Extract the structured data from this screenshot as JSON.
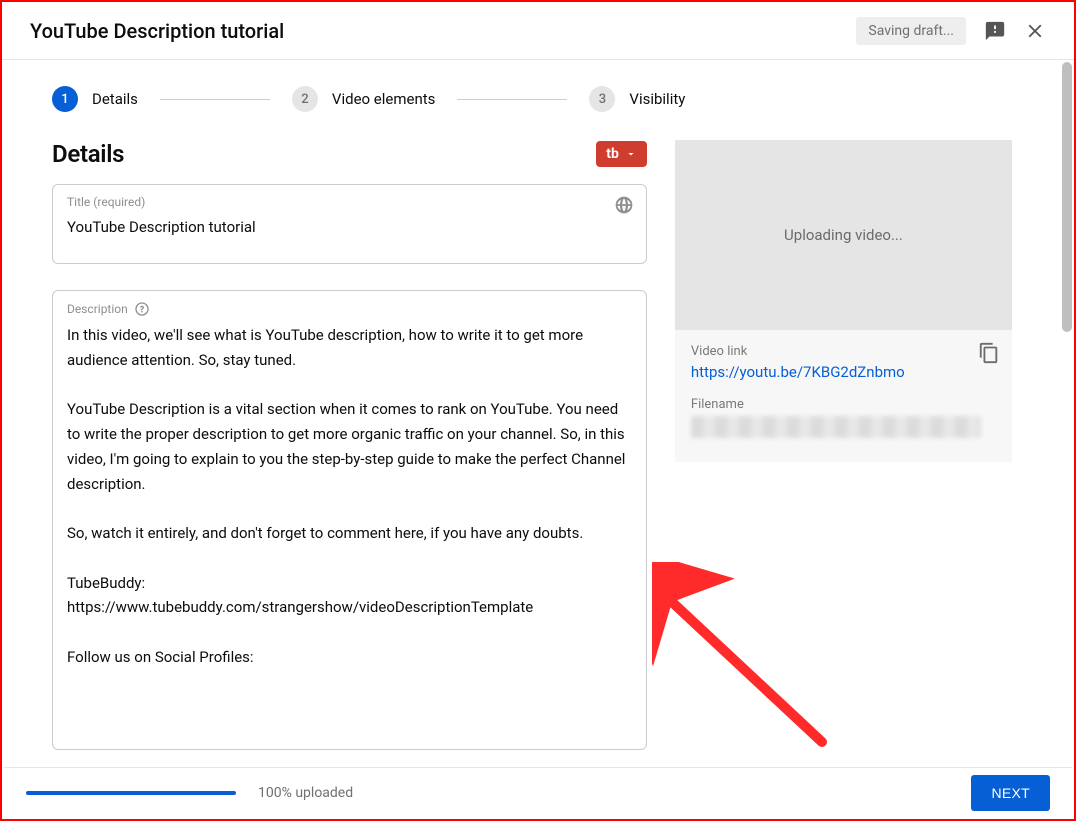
{
  "header": {
    "title": "YouTube Description tutorial",
    "saving_label": "Saving draft..."
  },
  "stepper": {
    "steps": [
      {
        "num": "1",
        "label": "Details",
        "active": true
      },
      {
        "num": "2",
        "label": "Video elements",
        "active": false
      },
      {
        "num": "3",
        "label": "Visibility",
        "active": false
      }
    ]
  },
  "details": {
    "section_title": "Details",
    "tb_label": "tb",
    "title_field_label": "Title (required)",
    "title_value": "YouTube Description tutorial",
    "desc_field_label": "Description",
    "desc_value": "In this video, we'll see what is YouTube description, how to write it to get more audience attention. So, stay tuned.\n\nYouTube Description is a vital section when it comes to rank on YouTube. You need to write the proper description to get more organic traffic on your channel. So, in this video, I'm going to explain to you the step-by-step guide to make the perfect Channel description.\n\nSo, watch it entirely, and don't forget to comment here, if you have any doubts.\n\nTubeBuddy:\nhttps://www.tubebuddy.com/strangershow/videoDescriptionTemplate\n\nFollow us on Social Profiles:"
  },
  "preview": {
    "thumb_status": "Uploading video...",
    "video_link_label": "Video link",
    "video_link": "https://youtu.be/7KBG2dZnbmo",
    "filename_label": "Filename"
  },
  "footer": {
    "upload_text": "100% uploaded",
    "progress_pct": 100,
    "next_label": "NEXT"
  }
}
